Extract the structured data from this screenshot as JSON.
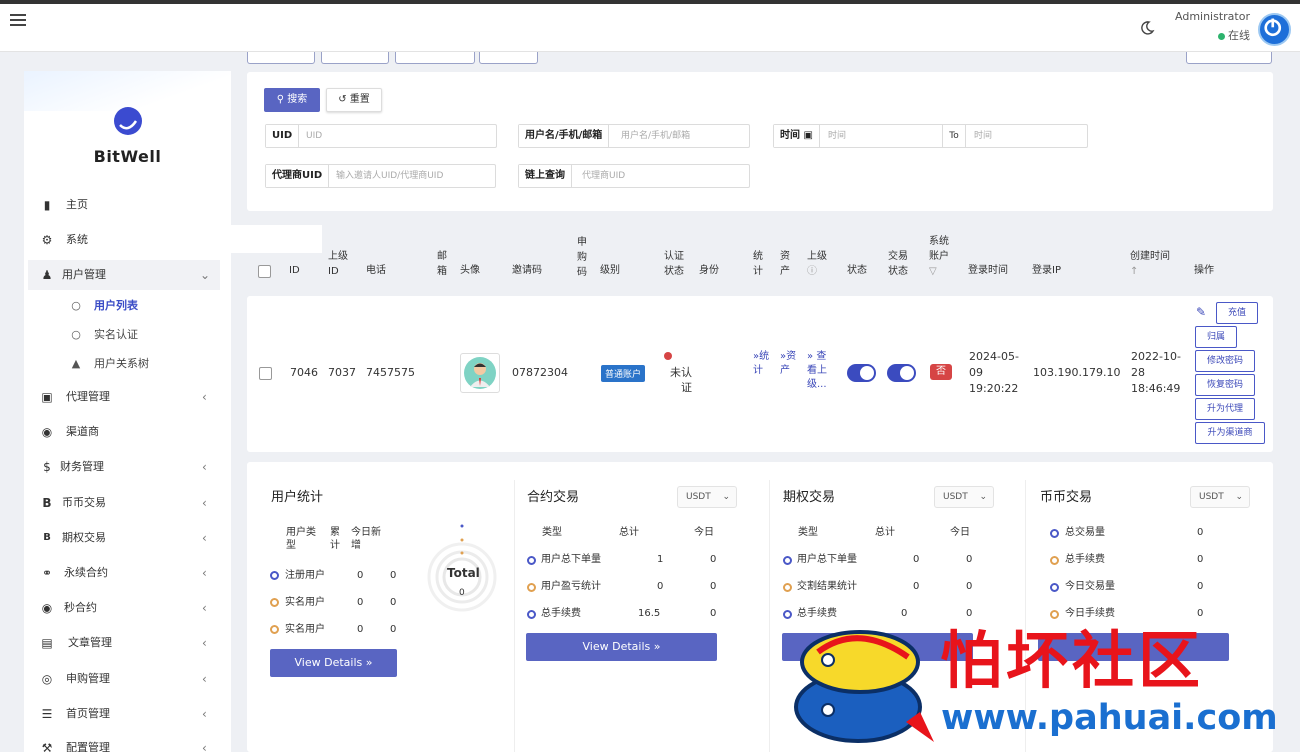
{
  "topbar": {
    "user": "Administrator",
    "status": "在线"
  },
  "sidebar": {
    "brand": "BitWell",
    "items": [
      {
        "label": "主页",
        "icon": "bar-chart-icon"
      },
      {
        "label": "系统",
        "icon": "gear-icon"
      },
      {
        "label": "用户管理",
        "icon": "users-icon"
      },
      {
        "label": "代理管理",
        "icon": "id-card-icon"
      },
      {
        "label": "渠道商",
        "icon": "user-circle-icon"
      },
      {
        "label": "财务管理",
        "icon": "dollar-icon"
      },
      {
        "label": "币币交易",
        "icon": "bitcoin-icon"
      },
      {
        "label": "期权交易",
        "icon": "bitcoin-small-icon"
      },
      {
        "label": "永续合约",
        "icon": "link-icon"
      },
      {
        "label": "秒合约",
        "icon": "dot-circle-icon"
      },
      {
        "label": "文章管理",
        "icon": "newspaper-icon"
      },
      {
        "label": "申购管理",
        "icon": "lifebuoy-icon"
      },
      {
        "label": "首页管理",
        "icon": "list-icon"
      },
      {
        "label": "配置管理",
        "icon": "wrench-icon"
      }
    ],
    "sub": [
      {
        "label": "用户列表",
        "icon": "circle-icon"
      },
      {
        "label": "实名认证",
        "icon": "circle-icon"
      },
      {
        "label": "用户关系树",
        "icon": "tree-icon"
      }
    ]
  },
  "search": {
    "search_btn": "搜索",
    "reset_btn": "重置",
    "uid_label": "UID",
    "uid_ph": "UID",
    "user_label": "用户名/手机/邮箱",
    "user_ph": "用户名/手机/邮箱",
    "time_label": "时间",
    "time_ph": "时间",
    "to_label": "To",
    "time2_ph": "时间",
    "agent_label": "代理商UID",
    "agent_ph": "输入邀请人UID/代理商UID",
    "chain_label": "链上查询",
    "chain_ph": "代理商UID"
  },
  "table": {
    "headers": {
      "id": "ID",
      "parent_id": "上级ID",
      "phone": "电话",
      "email": "邮箱",
      "avatar": "头像",
      "invite": "邀请码",
      "purchase": "申购码",
      "level": "级别",
      "verify": "认证状态",
      "identity": "身份",
      "stats": "统计",
      "assets": "资产",
      "parent": "上级",
      "status": "状态",
      "trade_status": "交易状态",
      "sys_account": "系统账户",
      "login_time": "登录时间",
      "login_ip": "登录IP",
      "created": "创建时间",
      "ops": "操作"
    },
    "row": {
      "id": "7046",
      "parent_id": "7037",
      "phone": "7457575",
      "invite": "07872304",
      "level": "普通账户",
      "verify": "未认证",
      "stats_link": "统计",
      "assets_link": "资产",
      "parent_link": "查看上级...",
      "sys_account": "否",
      "login_time": "2024-05-09 19:20:22",
      "login_ip": "103.190.179.10",
      "created": "2022-10-28 18:46:49",
      "ops": [
        "充值",
        "归属",
        "修改密码",
        "恢复密码",
        "升为代理",
        "升为渠道商"
      ]
    }
  },
  "stats": {
    "user": {
      "title": "用户统计",
      "h_type": "用户类型",
      "h_total": "累计",
      "h_today": "今日新增",
      "rows": [
        {
          "label": "注册用户",
          "total": "0",
          "today": "0",
          "color": "#4a58c7"
        },
        {
          "label": "实名用户",
          "total": "0",
          "today": "0",
          "color": "#e0a050"
        },
        {
          "label": "实名用户",
          "total": "0",
          "today": "0",
          "color": "#e0a050"
        }
      ],
      "donut_label": "Total",
      "donut_value": "0",
      "btn": "View Details"
    },
    "contract": {
      "title": "合约交易",
      "currency": "USDT",
      "h_type": "类型",
      "h_total": "总计",
      "h_today": "今日",
      "rows": [
        {
          "label": "用户总下单量",
          "total": "1",
          "today": "0",
          "color": "#4a58c7"
        },
        {
          "label": "用户盈亏统计",
          "total": "0",
          "today": "0",
          "color": "#e0a050"
        },
        {
          "label": "总手续费",
          "total": "16.5",
          "today": "0",
          "color": "#4a58c7"
        }
      ],
      "btn": "View Details"
    },
    "option": {
      "title": "期权交易",
      "currency": "USDT",
      "h_type": "类型",
      "h_total": "总计",
      "h_today": "今日",
      "rows": [
        {
          "label": "用户总下单量",
          "total": "0",
          "today": "0",
          "color": "#4a58c7"
        },
        {
          "label": "交割结果统计",
          "total": "0",
          "today": "0",
          "color": "#e0a050"
        },
        {
          "label": "总手续费",
          "total": "0",
          "today": "0",
          "color": "#4a58c7"
        }
      ]
    },
    "spot": {
      "title": "币币交易",
      "currency": "USDT",
      "rows": [
        {
          "label": "总交易量",
          "value": "0",
          "color": "#4a58c7"
        },
        {
          "label": "总手续费",
          "value": "0",
          "color": "#e0a050"
        },
        {
          "label": "今日交易量",
          "value": "0",
          "color": "#4a58c7"
        },
        {
          "label": "今日手续费",
          "value": "0",
          "color": "#e0a050"
        }
      ]
    }
  },
  "watermark": {
    "cn": "怕坏社区",
    "url": "www.pahuai.com"
  }
}
